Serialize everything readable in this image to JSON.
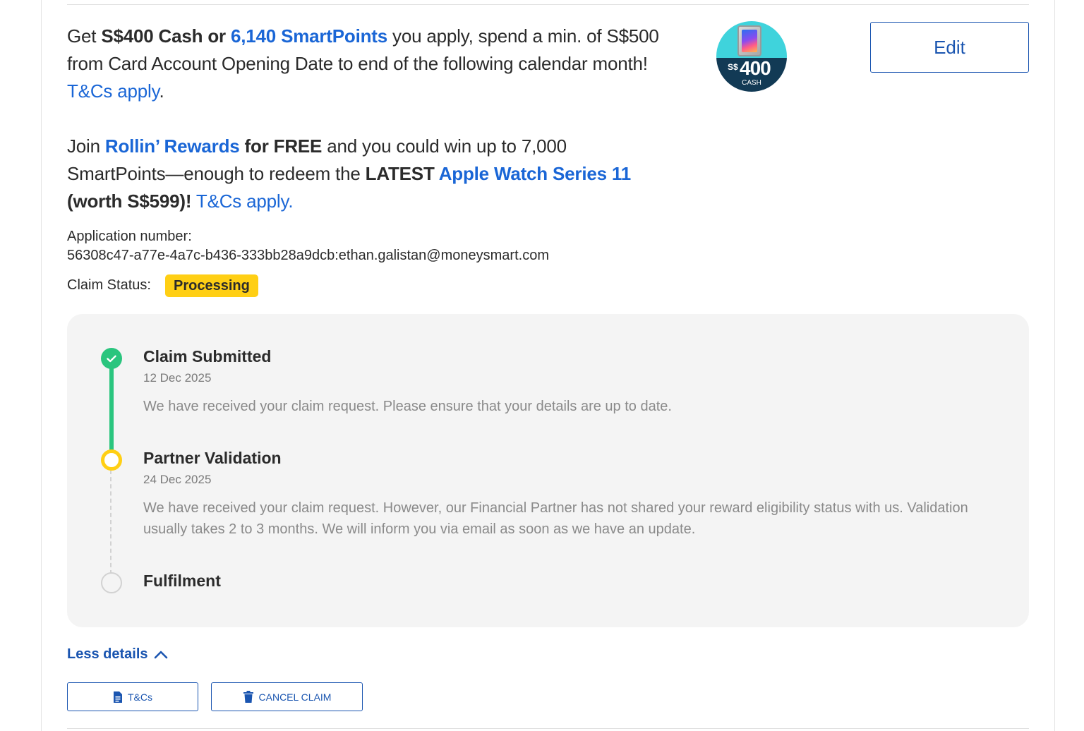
{
  "promo1": {
    "get": "Get ",
    "cash": "S$400 Cash or ",
    "points": "6,140 SmartPoints",
    "text": " you apply, spend a min. of S$500 from Card Account Opening Date to end of the following calendar month! ",
    "tcs": "T&Cs apply",
    "end": "."
  },
  "promo2": {
    "join": "Join ",
    "rollin": "Rollin’ Rewards",
    "free": " for FREE",
    "text": " and you could win up to 7,000 SmartPoints—enough to redeem the ",
    "latest": "LATEST ",
    "watch": "Apple Watch Series 11",
    "worth": " (worth S$599)!",
    "tcs": " T&Cs apply."
  },
  "badge": {
    "currency": "S$",
    "amount": "400",
    "label": "CASH"
  },
  "edit_label": "Edit",
  "application": {
    "label": "Application number:",
    "number": "56308c47-a77e-4a7c-b436-333bb28a9dcb:ethan.galistan@moneysmart.com"
  },
  "claim": {
    "label": "Claim Status:",
    "status": "Processing"
  },
  "timeline": [
    {
      "title": "Claim Submitted",
      "date": "12 Dec 2025",
      "desc": "We have received your claim request. Please ensure that your details are up to date.",
      "state": "done"
    },
    {
      "title": "Partner Validation",
      "date": "24 Dec 2025",
      "desc": "We have received your claim request. However, our Financial Partner has not shared your reward eligibility status with us. Validation usually takes 2 to 3 months. We will inform you via email as soon as we have an update.",
      "state": "active"
    },
    {
      "title": "Fulfilment",
      "date": "",
      "desc": "",
      "state": "pending"
    }
  ],
  "less_details": "Less details",
  "buttons": {
    "tcs": "T&Cs",
    "cancel": "CANCEL CLAIM"
  },
  "colors": {
    "accent": "#1a55b0",
    "link": "#1a66d6",
    "success": "#2ac57e",
    "warning": "#ffcf14"
  }
}
